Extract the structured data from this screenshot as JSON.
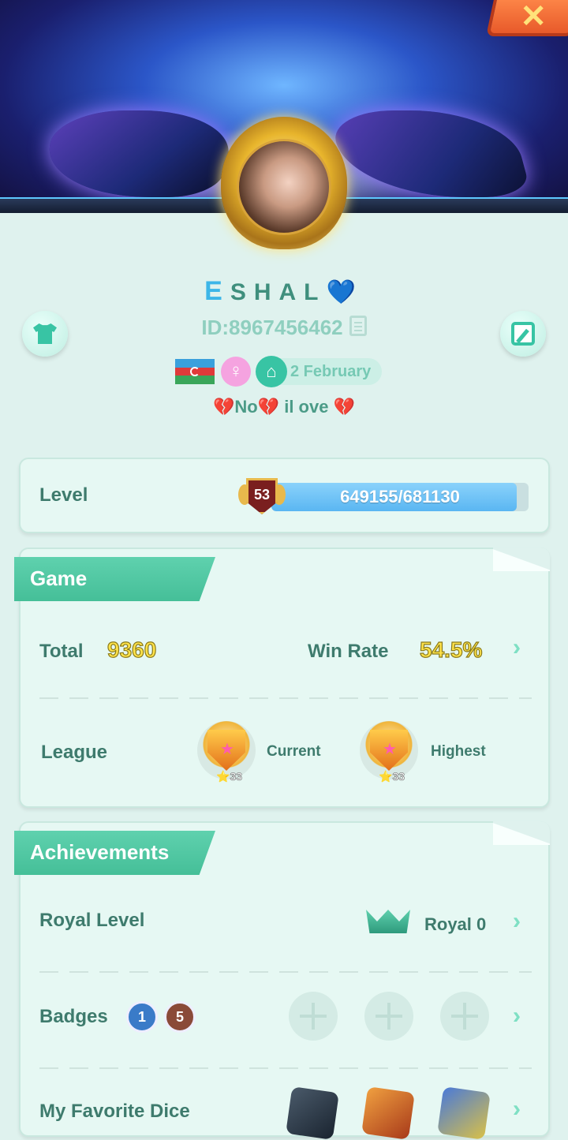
{
  "profile": {
    "name_first": "E",
    "name_rest": "SHAL",
    "name_emoji": "💙",
    "id_text": "ID:8967456462",
    "birthday": "2 February",
    "status": "💔No💔  il ove 💔",
    "gender_symbol": "♀",
    "flag": "azerbaijan-flag"
  },
  "level": {
    "label": "Level",
    "number": "53",
    "progress_text": "649155/681130",
    "progress_fraction": 0.953
  },
  "game": {
    "title": "Game",
    "total_label": "Total",
    "total_value": "9360",
    "winrate_label": "Win Rate",
    "winrate_value": "54.5%",
    "league_label": "League",
    "current_label": "Current",
    "current_stars": "33",
    "highest_label": "Highest",
    "highest_stars": "33"
  },
  "achievements": {
    "title": "Achievements",
    "royal_label": "Royal Level",
    "royal_value": "Royal 0",
    "badges_label": "Badges",
    "badge_blue": "1",
    "badge_brown": "5",
    "dice_label": "My Favorite Dice"
  },
  "colors": {
    "accent": "#45bf98",
    "background": "#dff2ee",
    "progress": "#5ab6f2",
    "value_yellow": "#ffe34a"
  }
}
